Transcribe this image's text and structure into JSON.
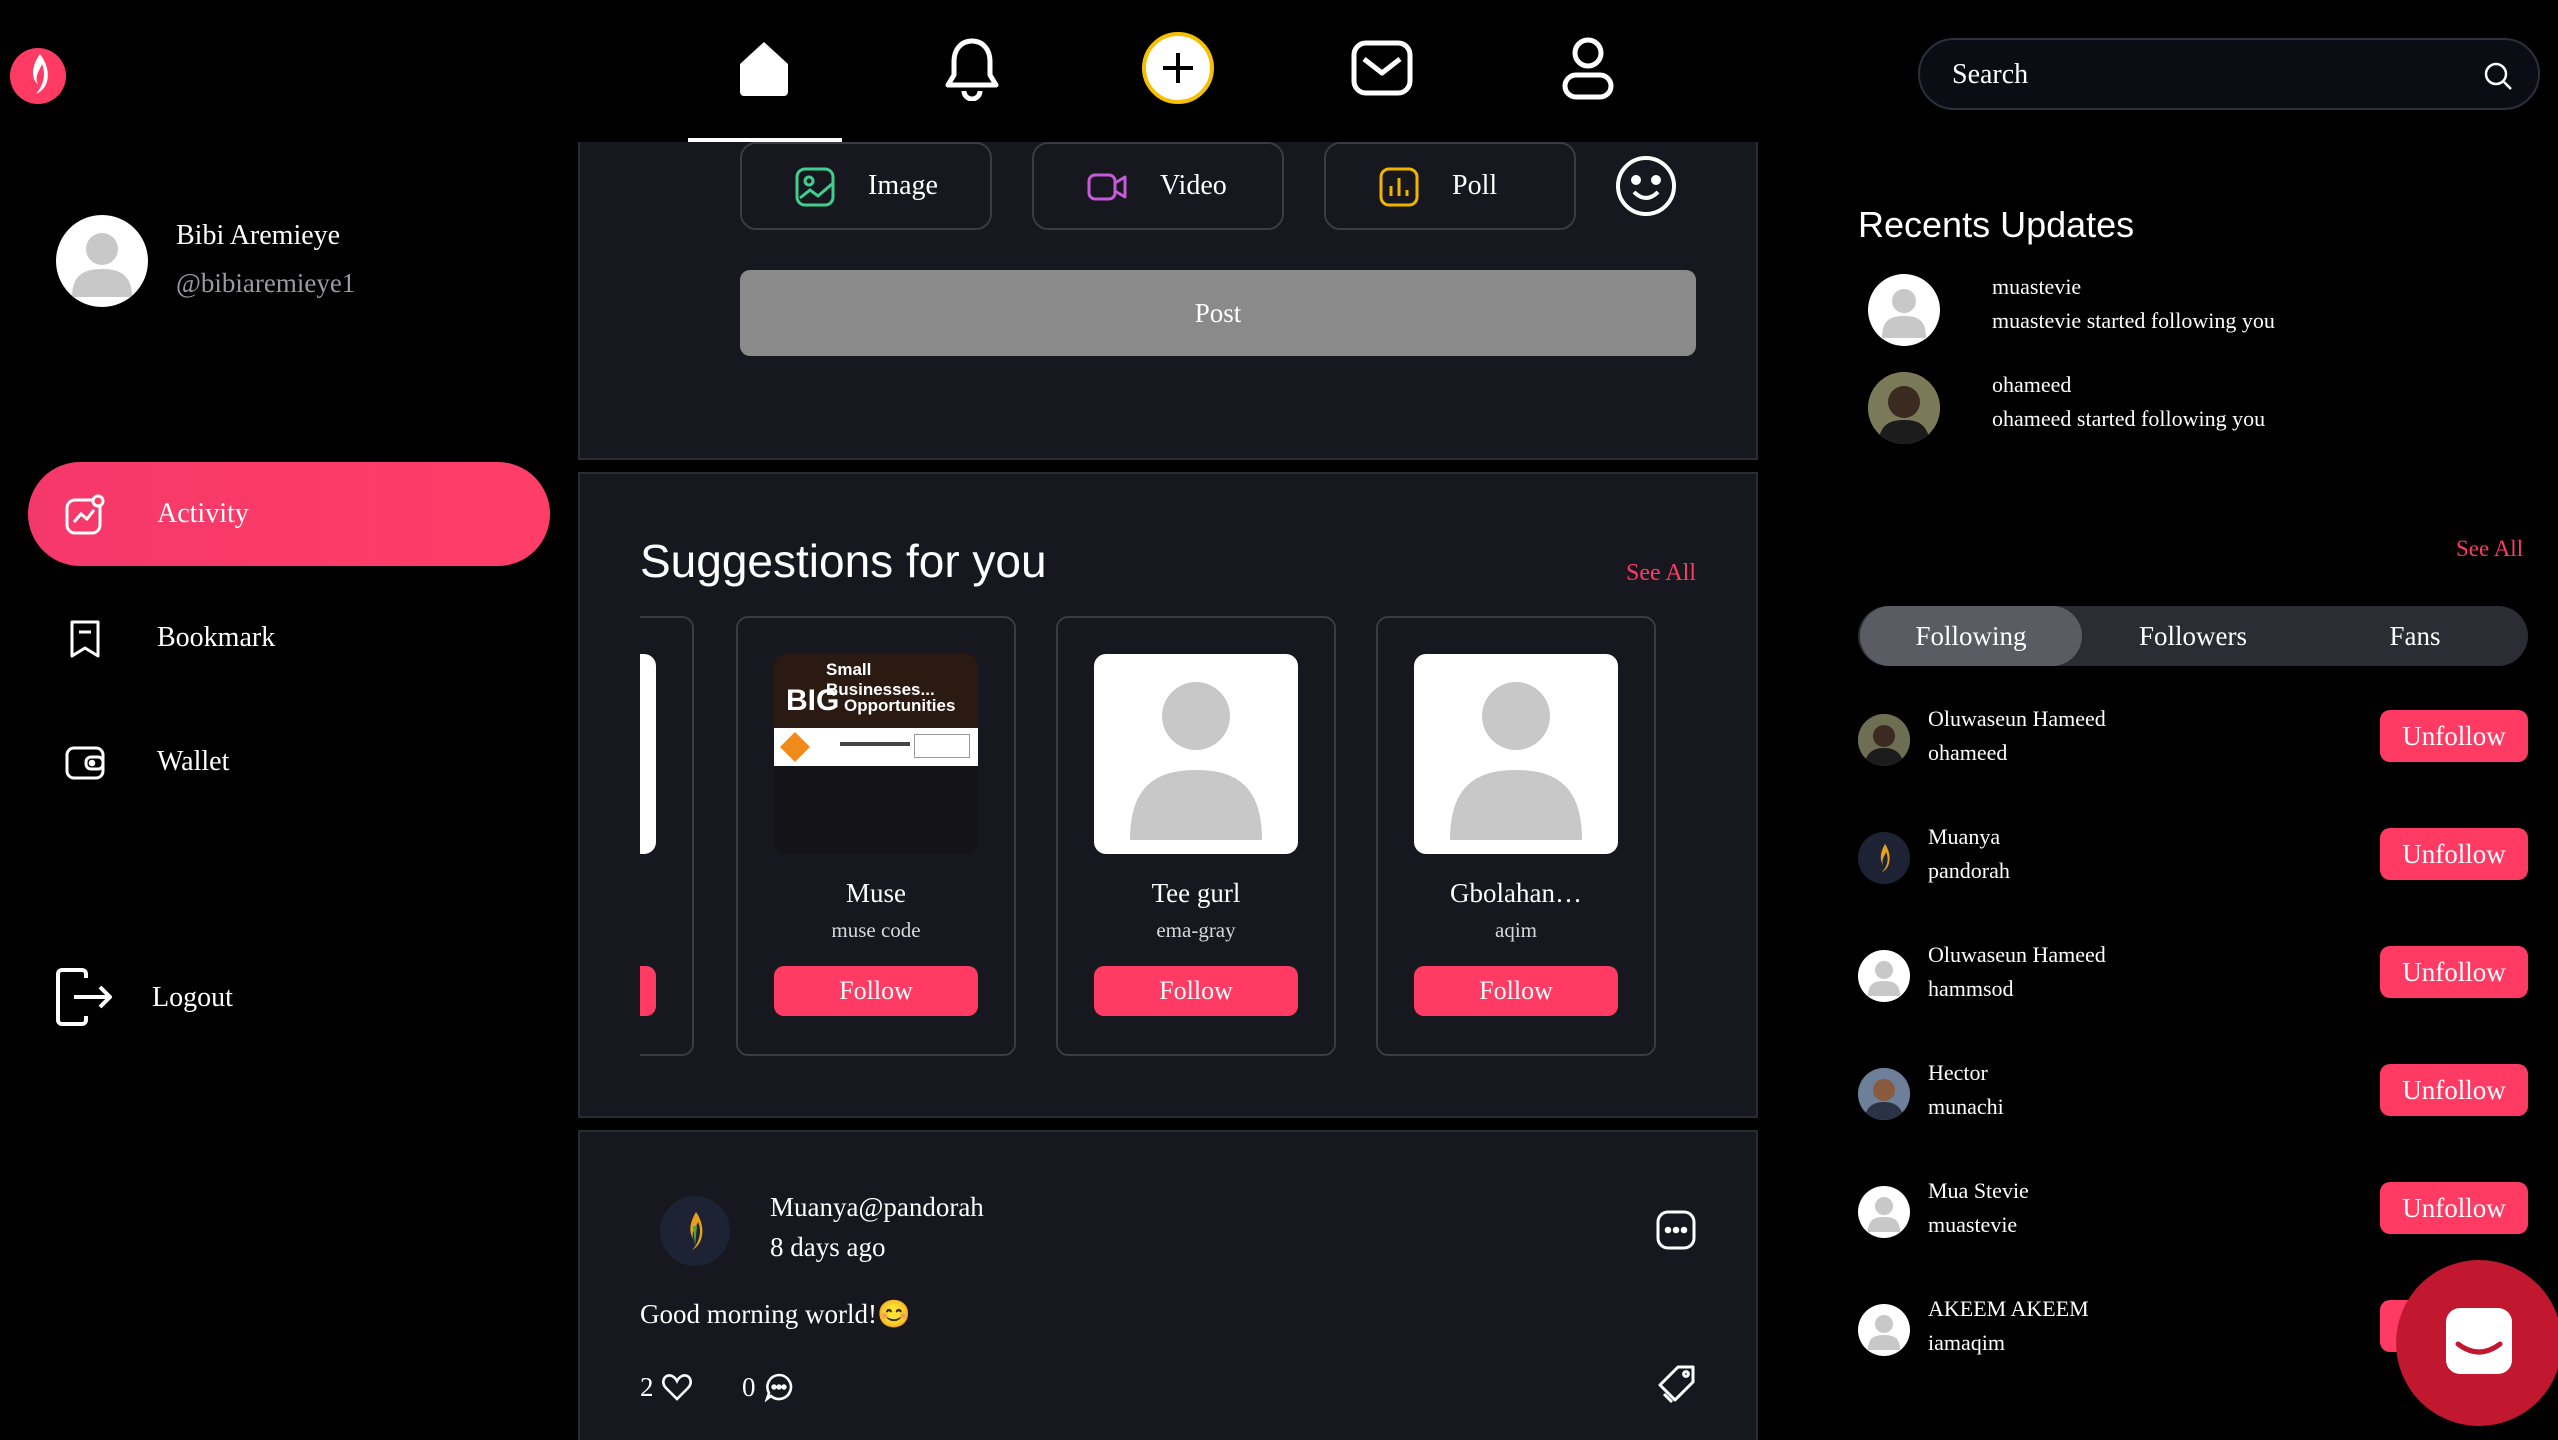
{
  "nav": {
    "home": "home-icon",
    "notifications": "bell-icon",
    "create": "plus-icon",
    "messages": "mail-icon",
    "profile": "user-icon",
    "search_placeholder": "Search"
  },
  "sidebar": {
    "user_name": "Bibi Aremieye",
    "user_handle": "@bibiaremieye1",
    "items": [
      {
        "label": "Activity",
        "icon": "activity-icon",
        "active": true
      },
      {
        "label": "Bookmark",
        "icon": "bookmark-icon"
      },
      {
        "label": "Wallet",
        "icon": "wallet-icon"
      }
    ],
    "logout_label": "Logout"
  },
  "composer": {
    "buttons": [
      {
        "label": "Image",
        "icon": "image-icon"
      },
      {
        "label": "Video",
        "icon": "video-icon"
      },
      {
        "label": "Poll",
        "icon": "poll-icon"
      }
    ],
    "post_label": "Post"
  },
  "suggestions": {
    "title": "Suggestions for you",
    "see_all": "See All",
    "partial_name": ".",
    "cards": [
      {
        "name": "Muse",
        "handle": "muse code",
        "follow": "Follow",
        "banner_top": "Small Businesses...",
        "banner_big": "BIG",
        "banner_rest": "Opportunities"
      },
      {
        "name": "Tee gurl",
        "handle": "ema-gray",
        "follow": "Follow"
      },
      {
        "name": "Gbolahan…",
        "handle": "aqim",
        "follow": "Follow"
      }
    ]
  },
  "post": {
    "author": "Muanya@pandorah",
    "time": "8 days ago",
    "text": "Good morning world!😊",
    "likes": "2",
    "comments": "0"
  },
  "recents": {
    "title": "Recents Updates",
    "items": [
      {
        "user": "muastevie",
        "text": "muastevie started following you"
      },
      {
        "user": "ohameed",
        "text": "ohameed started following you"
      }
    ],
    "see_all": "See All"
  },
  "follow_tabs": [
    "Following",
    "Followers",
    "Fans"
  ],
  "following": [
    {
      "name": "Oluwaseun Hameed",
      "user": "ohameed",
      "action": "Unfollow"
    },
    {
      "name": "Muanya",
      "user": "pandorah",
      "action": "Unfollow"
    },
    {
      "name": "Oluwaseun Hameed",
      "user": "hammsod",
      "action": "Unfollow"
    },
    {
      "name": "Hector",
      "user": "munachi",
      "action": "Unfollow"
    },
    {
      "name": "Mua Stevie",
      "user": "muastevie",
      "action": "Unfollow"
    },
    {
      "name": "AKEEM AKEEM",
      "user": "iamaqim",
      "action": "Unfollow"
    }
  ],
  "colors": {
    "accent": "#ff3b64",
    "panel": "#16171f",
    "background": "#000000"
  }
}
